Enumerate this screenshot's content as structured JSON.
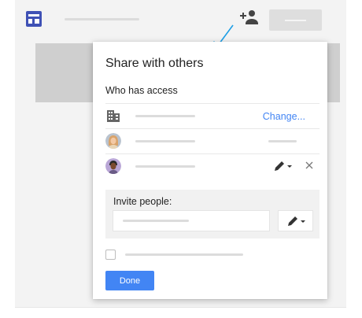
{
  "dialog": {
    "title": "Share with others",
    "access_heading": "Who has access",
    "rows": [
      {
        "icon": "building-icon",
        "action_label": "Change..."
      },
      {
        "icon": "avatar-woman"
      },
      {
        "icon": "avatar-man",
        "permission_icon": "pencil-icon",
        "remove_icon": "close-icon"
      }
    ],
    "invite": {
      "label": "Invite people:",
      "input_value": "",
      "permission_icon": "pencil-icon"
    },
    "done_label": "Done"
  },
  "colors": {
    "accent": "#4285f4",
    "app_logo": "#3f51b5",
    "arrow": "#1e9fe6",
    "icon_dark": "#444444"
  }
}
